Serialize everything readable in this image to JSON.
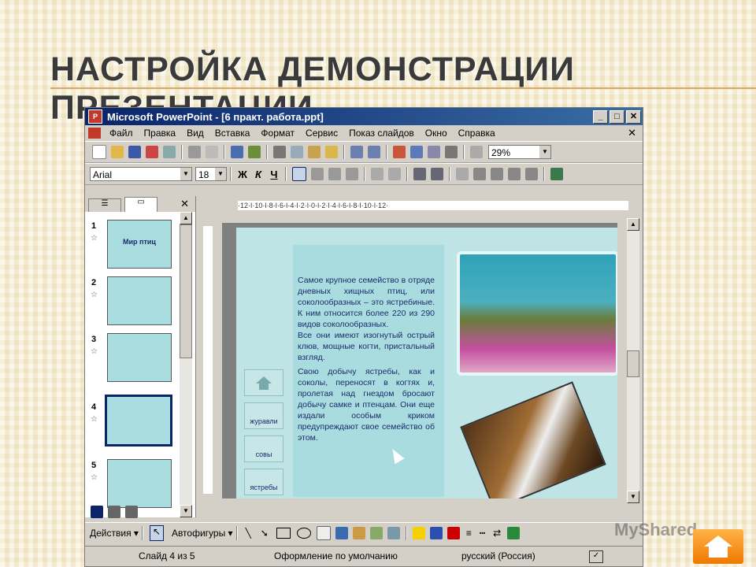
{
  "slide": {
    "title": "НАСТРОЙКА ДЕМОНСТРАЦИИ ПРЕЗЕНТАЦИИ"
  },
  "window": {
    "title": "Microsoft PowerPoint - [6 практ. работа.ppt]",
    "minimize": "_",
    "maximize": "□",
    "close": "✕"
  },
  "menu": {
    "items": [
      "Файл",
      "Правка",
      "Вид",
      "Вставка",
      "Формат",
      "Сервис",
      "Показ слайдов",
      "Окно",
      "Справка"
    ],
    "close_doc": "✕"
  },
  "toolbar": {
    "zoom": "29%"
  },
  "format_toolbar": {
    "font": "Arial",
    "size": "18",
    "bold": "Ж",
    "italic": "К",
    "underline": "Ч"
  },
  "left_pane": {
    "close": "✕",
    "thumbnails": [
      "1",
      "2",
      "3",
      "4",
      "5"
    ],
    "selected": "4"
  },
  "ruler": {
    "horizontal": "·12·ǀ·10·ǀ·8·ǀ·6·ǀ·4·ǀ·2·ǀ·0·ǀ·2·ǀ·4·ǀ·6·ǀ·8·ǀ·10·ǀ·12·"
  },
  "slide_content": {
    "thumb_title": "Мир птиц",
    "paragraph1": "Самое крупное семейство в отряде дневных хищных птиц, или соколообразных – это ястребиные. К ним относится более 220 из 290 видов соколообразных.",
    "paragraph2": "Все они имеют изогнутый острый клюв, мощные когти, пристальный взгляд.",
    "paragraph3": "Свою добычу ястребы, как и соколы, переносят в когтях и, пролетая над гнездом бросают добычу самке и птенцам. Они еще издали особым криком предупреждают свое семейство об этом.",
    "nav_buttons": [
      "журавли",
      "совы",
      "ястребы"
    ]
  },
  "draw_toolbar": {
    "actions": "Действия ▾",
    "autoshapes": "Автофигуры ▾"
  },
  "status": {
    "slide": "Слайд 4 из 5",
    "design": "Оформление по умолчанию",
    "language": "русский (Россия)"
  },
  "watermark": "MyShared"
}
